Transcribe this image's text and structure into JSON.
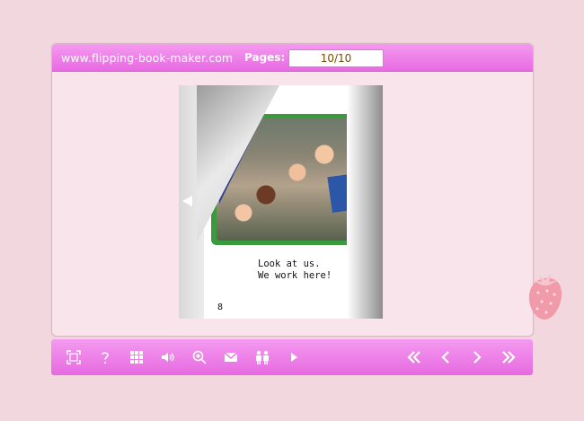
{
  "header": {
    "site": "www.flipping-book-maker.com",
    "pages_label": "Pages:",
    "pages_value": "10/10"
  },
  "page": {
    "caption": "Look at us.\nWe work here!",
    "number": "8"
  },
  "toolbar": {
    "left_buttons": [
      "fullscreen-icon",
      "help-icon",
      "thumbnails-icon",
      "sound-icon",
      "zoom-in-icon",
      "email-icon",
      "share-icon",
      "autoplay-icon"
    ],
    "right_buttons": [
      "first-page-icon",
      "previous-page-icon",
      "next-page-icon",
      "last-page-icon"
    ]
  },
  "colors": {
    "accent": "#e86ae2",
    "background": "#f3d7df"
  }
}
